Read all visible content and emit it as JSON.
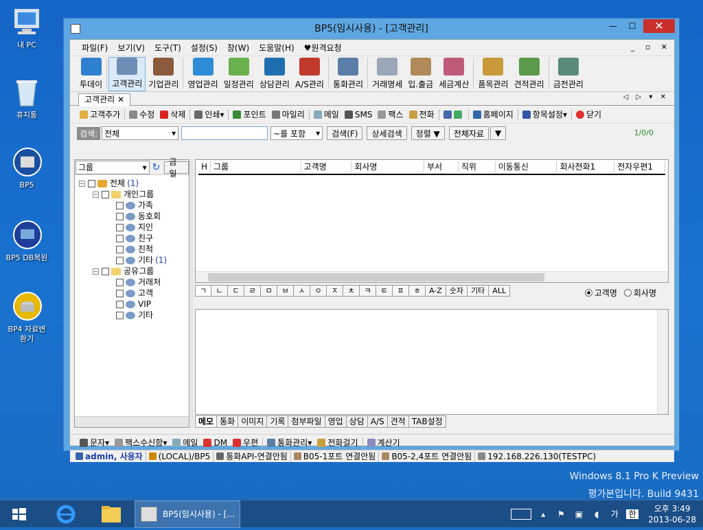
{
  "desktop": {
    "icons": [
      {
        "label": "내 PC"
      },
      {
        "label": "휴지통"
      },
      {
        "label": "BP5"
      },
      {
        "label": "BP5 DB복원"
      },
      {
        "label": "BP4 자료변환기"
      }
    ],
    "watermark_line1": "Windows 8.1 Pro K Preview",
    "watermark_line2": "평가본입니다. Build 9431"
  },
  "window": {
    "title": "BP5(임시사용) - [고객관리]",
    "menu": [
      "파일(F)",
      "보기(V)",
      "도구(T)",
      "설정(S)",
      "창(W)",
      "도움말(H)",
      "♥원격요청"
    ],
    "toolbar": [
      {
        "label": "투데이",
        "color": "#2f7fd0"
      },
      {
        "label": "고객관리",
        "color": "#6d8fb5"
      },
      {
        "label": "기업관리",
        "color": "#8a5a3a"
      },
      {
        "label": "영업관리",
        "color": "#2e8bd6"
      },
      {
        "label": "일정관리",
        "color": "#6ab04c"
      },
      {
        "label": "상담관리",
        "color": "#1f6fb0"
      },
      {
        "label": "A/S관리",
        "color": "#c0392b"
      },
      {
        "label": "통화관리",
        "color": "#5a7ea8"
      },
      {
        "label": "거래명세",
        "color": "#9aa7b8"
      },
      {
        "label": "입.출금",
        "color": "#b08a5a"
      },
      {
        "label": "세금계산",
        "color": "#c05a7a"
      },
      {
        "label": "품목관리",
        "color": "#c89a3a"
      },
      {
        "label": "견적관리",
        "color": "#5a9a4a"
      },
      {
        "label": "금전관리",
        "color": "#5a8a7a"
      }
    ],
    "doc_tab": "고객관리",
    "actions": [
      "고객추가",
      "수정",
      "삭제",
      "인쇄",
      "포인트",
      "마일리",
      "메일",
      "SMS",
      "팩스",
      "전화",
      "홈페이지",
      "항목설정",
      "닫기"
    ],
    "search": {
      "label": "검색:",
      "field_value": "전체",
      "input_value": "",
      "mode_value": "~를 포함",
      "search_btn": "검색(F)",
      "detail_btn": "상세검색",
      "sort_btn": "정렬 ▼",
      "all_btn": "전체자료",
      "more_btn": "▼",
      "count": "1/0/0"
    },
    "group_panel": {
      "selector": "그룹",
      "sort_btn": "금일",
      "tree": [
        {
          "label": "전체",
          "count": "(1)"
        },
        {
          "label": "개인그룹"
        },
        {
          "label": "가족"
        },
        {
          "label": "동호회"
        },
        {
          "label": "지인"
        },
        {
          "label": "친구"
        },
        {
          "label": "친척"
        },
        {
          "label": "기타",
          "count": "(1)"
        },
        {
          "label": "공유그룹"
        },
        {
          "label": "거래처"
        },
        {
          "label": "고객"
        },
        {
          "label": "VIP"
        },
        {
          "label": "기타"
        }
      ]
    },
    "grid_columns": [
      "H",
      "그룹",
      "고객명",
      "회사명",
      "부서",
      "직위",
      "이동통신",
      "회사전화1",
      "전자우편1"
    ],
    "alpha_tabs": [
      "ㄱ",
      "ㄴ",
      "ㄷ",
      "ㄹ",
      "ㅁ",
      "ㅂ",
      "ㅅ",
      "ㅇ",
      "ㅈ",
      "ㅊ",
      "ㅋ",
      "ㅌ",
      "ㅍ",
      "ㅎ",
      "A-Z",
      "숫자",
      "기타",
      "ALL"
    ],
    "radios": [
      {
        "label": "고객명",
        "checked": true
      },
      {
        "label": "회사명",
        "checked": false
      }
    ],
    "detail_tabs": [
      "메모",
      "통화",
      "이미지",
      "기록",
      "첨부파일",
      "영업",
      "상담",
      "A/S",
      "견적",
      "TAB설정"
    ],
    "bottom_actions": [
      "문자",
      "팩스수신함",
      "메일",
      "DM",
      "우편",
      "통화관리",
      "전화걸기",
      "계산기"
    ],
    "status": [
      "admin, 사용자",
      "(LOCAL)/BP5",
      "통화API-연결안됨",
      "B05-1포트 연결안됨",
      "B05-2,4포트 연결안됨",
      "192.168.226.130(TESTPC)"
    ]
  },
  "taskbar": {
    "app_label": "BP5(임시사용) - [...",
    "tray_lang": "가",
    "tray_ime": "한",
    "time": "오후 3:49",
    "date": "2013-06-28"
  }
}
